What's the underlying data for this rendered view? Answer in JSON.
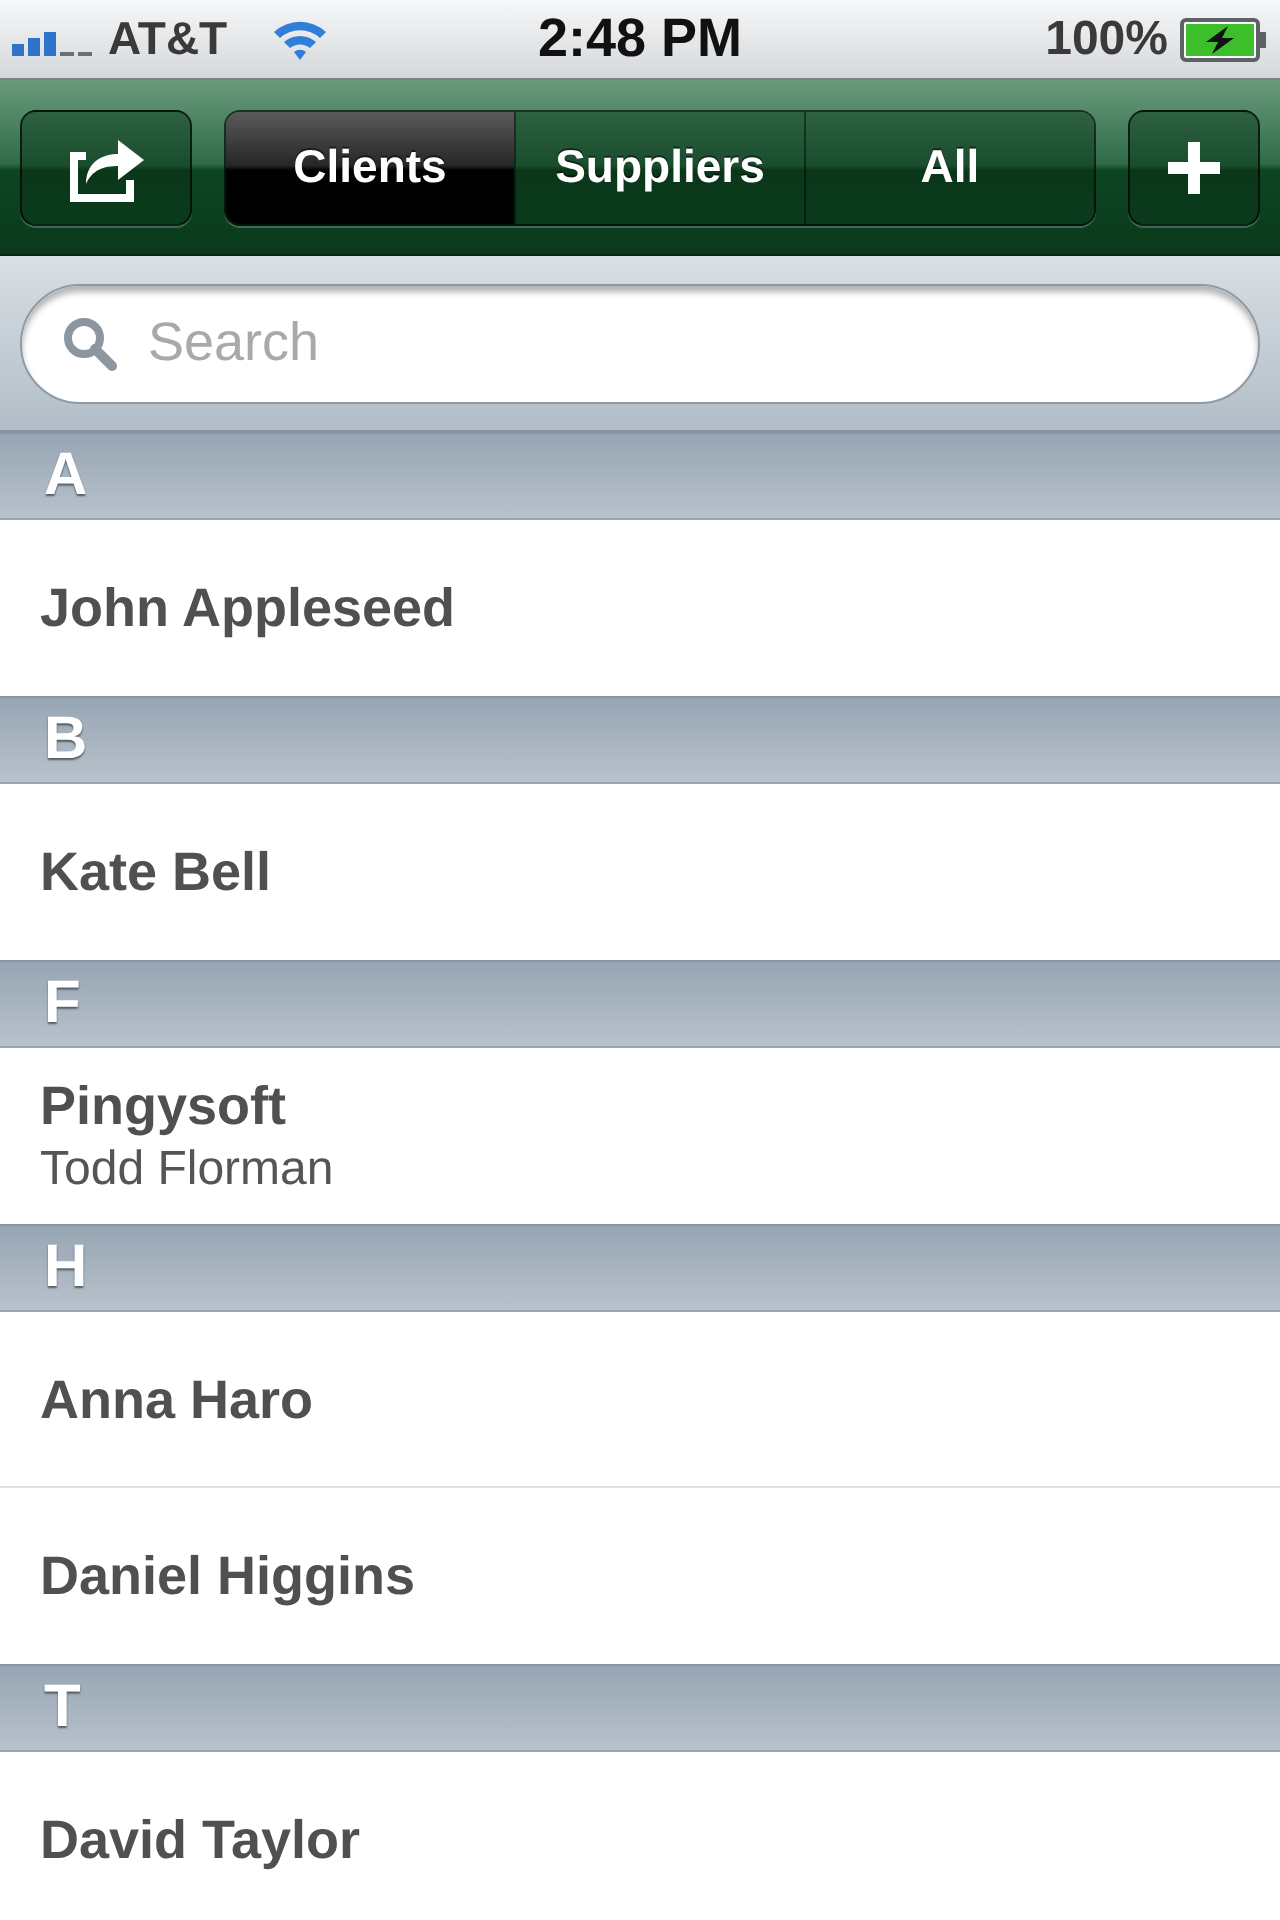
{
  "status_bar": {
    "carrier": "AT&T",
    "time": "2:48 PM",
    "battery": "100%"
  },
  "nav_bar": {
    "segments": [
      {
        "label": "Clients",
        "selected": true
      },
      {
        "label": "Suppliers",
        "selected": false
      },
      {
        "label": "All",
        "selected": false
      }
    ]
  },
  "search": {
    "placeholder": "Search"
  },
  "sections": [
    {
      "letter": "A",
      "rows": [
        {
          "title": "John Appleseed"
        }
      ]
    },
    {
      "letter": "B",
      "rows": [
        {
          "title": "Kate Bell"
        }
      ]
    },
    {
      "letter": "F",
      "rows": [
        {
          "title": "Pingysoft",
          "subtitle": "Todd Florman"
        }
      ]
    },
    {
      "letter": "H",
      "rows": [
        {
          "title": "Anna Haro"
        },
        {
          "title": "Daniel Higgins"
        }
      ]
    },
    {
      "letter": "T",
      "rows": [
        {
          "title": "David Taylor"
        }
      ]
    }
  ]
}
